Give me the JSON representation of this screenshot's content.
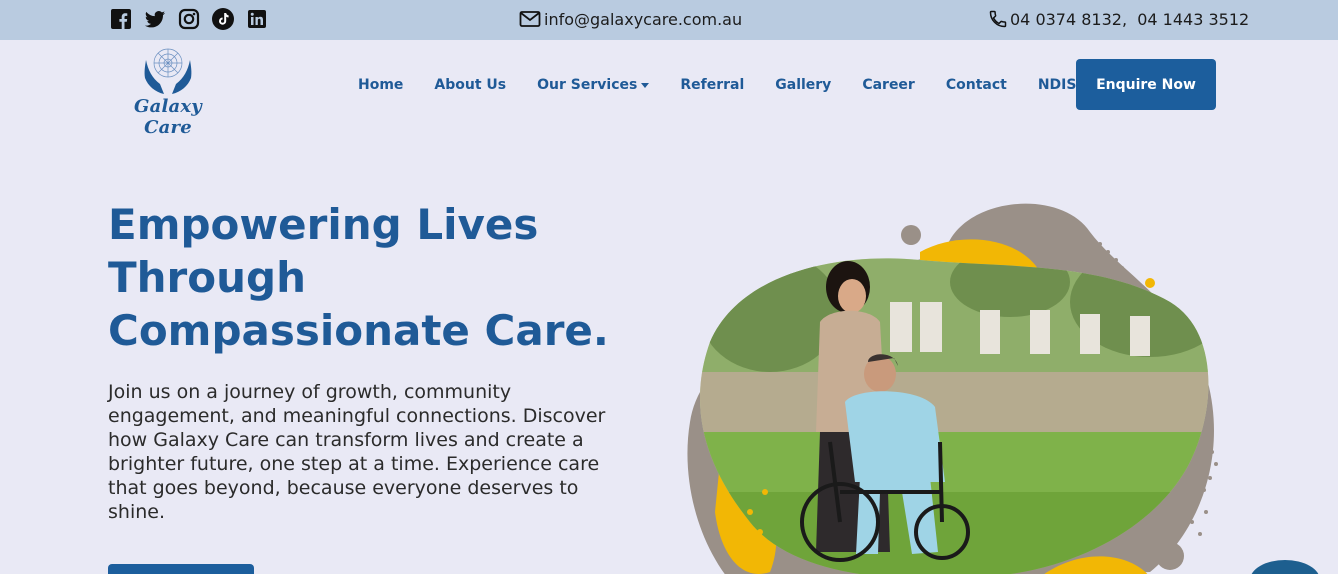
{
  "topbar": {
    "social_icons": [
      "facebook-icon",
      "twitter-icon",
      "instagram-icon",
      "tiktok-icon",
      "linkedin-icon"
    ],
    "email": "info@galaxycare.com.au",
    "phone": "04 0374 8132,  04 1443 3512"
  },
  "logo": {
    "text": "Galaxy Care"
  },
  "nav": {
    "items": [
      {
        "label": "Home",
        "dropdown": false
      },
      {
        "label": "About Us",
        "dropdown": false
      },
      {
        "label": "Our Services",
        "dropdown": true
      },
      {
        "label": "Referral",
        "dropdown": false
      },
      {
        "label": "Gallery",
        "dropdown": false
      },
      {
        "label": "Career",
        "dropdown": false
      },
      {
        "label": "Contact",
        "dropdown": false
      },
      {
        "label": "NDIS",
        "dropdown": true
      }
    ],
    "cta": "Enquire Now"
  },
  "hero": {
    "title_lines": [
      "Empowering Lives",
      "Through",
      "Compassionate Care."
    ],
    "text_lines": [
      "Join us on a journey of growth, community",
      "engagement, and meaningful connections. Discover",
      "how Galaxy Care can transform lives and create a",
      "brighter future, one step at a time. Experience care",
      "that goes beyond, because everyone deserves to",
      "shine."
    ]
  },
  "colors": {
    "topbar_bg": "#b9cbe0",
    "page_bg": "#e9e9f5",
    "brand_blue": "#1f5a97",
    "button_blue": "#1c5e9d",
    "accent_yellow": "#f2b705",
    "accent_gray": "#9a9088"
  }
}
